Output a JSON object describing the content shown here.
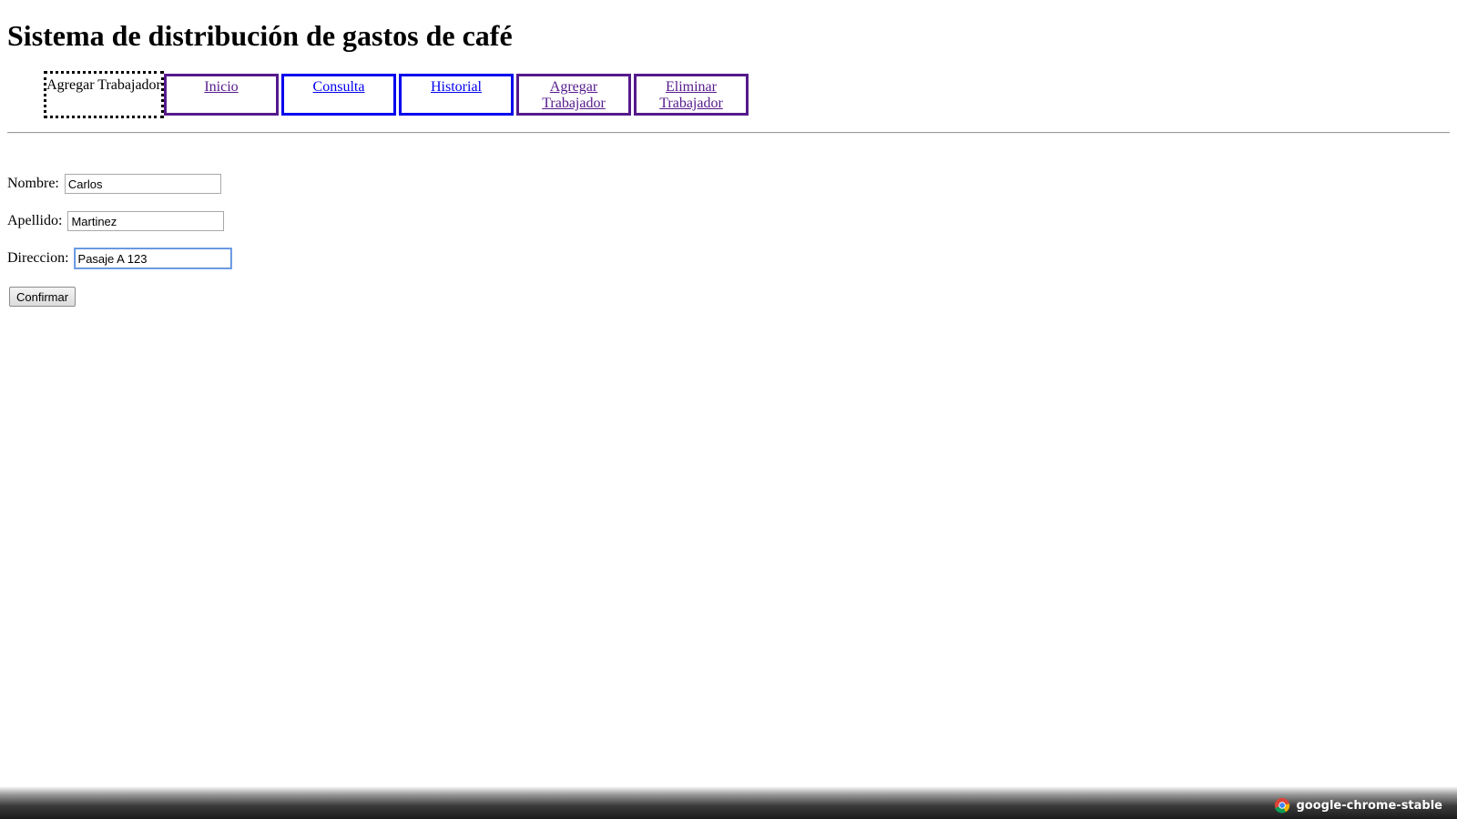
{
  "page": {
    "title": "Sistema de distribución de gastos de café"
  },
  "nav": {
    "items": [
      {
        "label": "Agregar Trabajador",
        "state": "active"
      },
      {
        "label": "Inicio",
        "state": "visited"
      },
      {
        "label": "Consulta",
        "state": "link"
      },
      {
        "label": "Historial",
        "state": "link"
      },
      {
        "label": "Agregar Trabajador",
        "state": "visited"
      },
      {
        "label": "Eliminar Trabajador",
        "state": "visited"
      }
    ]
  },
  "form": {
    "nombre_label": "Nombre:",
    "nombre_value": "Carlos",
    "apellido_label": "Apellido:",
    "apellido_value": "Martinez",
    "direccion_label": "Direccion:",
    "direccion_value": "Pasaje A 123 ",
    "confirm_label": "Confirmar"
  },
  "taskbar": {
    "app_name": "google-chrome-stable",
    "app_icon": "chrome-icon"
  },
  "colors": {
    "link": "#0000ee",
    "visited": "#551a8b",
    "focus": "#5b8dd9"
  }
}
